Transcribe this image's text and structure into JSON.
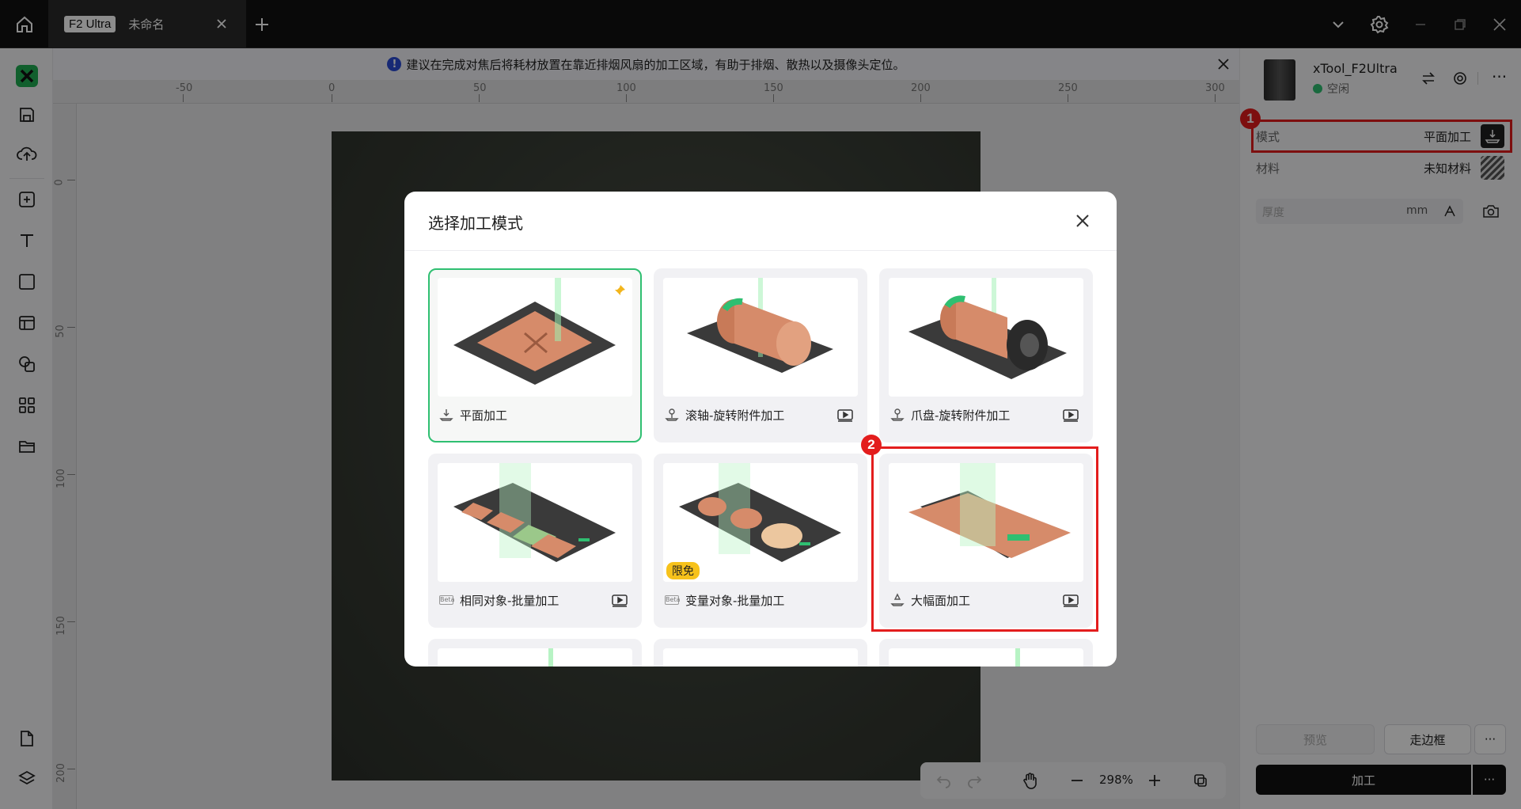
{
  "titlebar": {
    "tab_badge": "F2 Ultra",
    "tab_name": "未命名"
  },
  "notice": {
    "text": "建议在完成对焦后将耗材放置在靠近排烟风扇的加工区域，有助于排烟、散热以及摄像头定位。"
  },
  "ruler": {
    "top_labels": [
      "-50",
      "0",
      "50",
      "100",
      "150",
      "200",
      "250",
      "300"
    ],
    "left_labels": [
      "0",
      "50",
      "100",
      "150",
      "200"
    ]
  },
  "modal": {
    "title": "选择加工模式",
    "cards": [
      {
        "label": "平面加工",
        "selected": true,
        "pinned": true
      },
      {
        "label": "滚轴-旋转附件加工",
        "video": true
      },
      {
        "label": "爪盘-旋转附件加工",
        "video": true
      },
      {
        "label": "相同对象-批量加工",
        "video": true,
        "beta": true
      },
      {
        "label": "变量对象-批量加工",
        "beta": true,
        "tag": "限免"
      },
      {
        "label": "大幅面加工",
        "video": true
      }
    ]
  },
  "device": {
    "name": "xTool_F2Ultra",
    "status": "空闲",
    "status_color": "#2fbf71"
  },
  "settings": {
    "mode_label": "模式",
    "mode_value": "平面加工",
    "material_label": "材料",
    "material_value": "未知材料",
    "thickness_placeholder": "厚度",
    "thickness_unit": "mm"
  },
  "actions": {
    "preview": "预览",
    "frame": "走边框",
    "process": "加工"
  },
  "zoom": {
    "level": "298%"
  },
  "annotations": {
    "marker1": "1",
    "marker2": "2"
  },
  "colors": {
    "accent_green": "#2fbf71",
    "highlight_red": "#e31d1d",
    "logo_green": "#1fae52"
  }
}
